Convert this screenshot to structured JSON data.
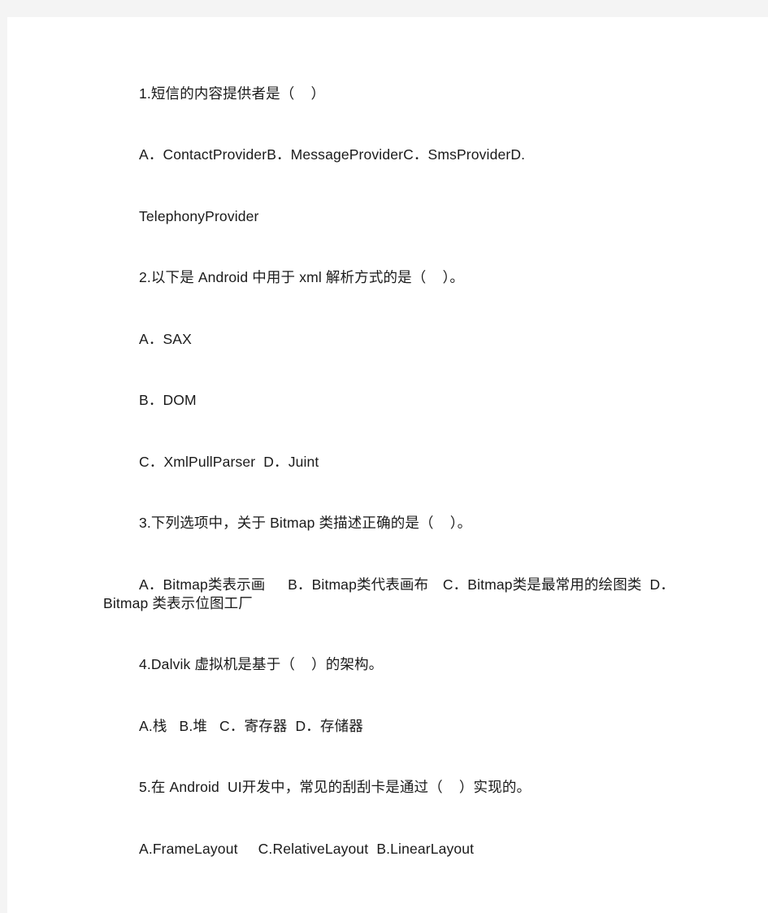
{
  "page": {
    "background_color": "#ffffff",
    "backdrop_color": "#f4f4f4",
    "text_color": "#1a1a1a"
  },
  "document": {
    "blocks": [
      {
        "id": "q1-stem",
        "kind": "question-stem",
        "text": "1.短信的内容提供者是（    ）"
      },
      {
        "id": "q1-options",
        "kind": "question-options",
        "text": "A．ContactProviderB．MessageProviderC．SmsProviderD."
      },
      {
        "id": "q1-options-cont",
        "kind": "question-options-continued",
        "text": "TelephonyProvider"
      },
      {
        "id": "q2-stem",
        "kind": "question-stem",
        "text": "2.以下是 Android 中用于 xml 解析方式的是（    ）。"
      },
      {
        "id": "q2-option-a",
        "kind": "question-options",
        "text": "A．SAX"
      },
      {
        "id": "q2-option-b",
        "kind": "question-options",
        "text": "B．DOM"
      },
      {
        "id": "q2-option-cd",
        "kind": "question-options",
        "text": "C．XmlPullParser  D．Juint"
      },
      {
        "id": "q3-stem",
        "kind": "question-stem",
        "text": "3.下列选项中，关于 Bitmap 类描述正确的是（    ）。"
      },
      {
        "id": "q3-options",
        "kind": "question-options",
        "text": "A．Bitmap类表示画　  B．Bitmap类代表画布　C．Bitmap类是最常用的绘图类  D．Bitmap 类表示位图工厂"
      },
      {
        "id": "q4-stem",
        "kind": "question-stem",
        "text": "4.Dalvik 虚拟机是基于（    ）的架构。"
      },
      {
        "id": "q4-options",
        "kind": "question-options",
        "text": "A.栈   B.堆   C．寄存器  D．存储器"
      },
      {
        "id": "q5-stem",
        "kind": "question-stem",
        "text": "5.在 Android  UI开发中，常见的刮刮卡是通过（    ）实现的。"
      },
      {
        "id": "q5-options",
        "kind": "question-options",
        "text": "A.FrameLayout     C.RelativeLayout  B.LinearLayout"
      }
    ]
  }
}
